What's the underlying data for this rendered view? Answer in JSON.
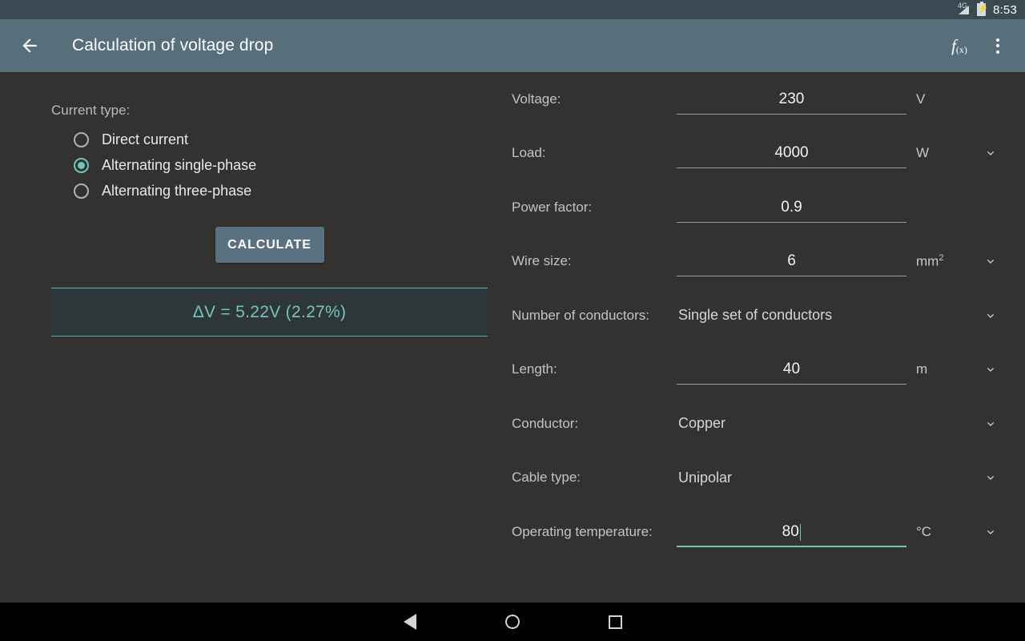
{
  "status_bar": {
    "network": "4G",
    "network_icon": "signal-4g-icon",
    "battery_icon": "battery-charging-icon",
    "time": "8:53"
  },
  "app_bar": {
    "back_icon": "arrow-back-icon",
    "title": "Calculation of voltage drop",
    "formula_icon": "fx-formula-icon",
    "formula_label": "f",
    "formula_sub": "(x)",
    "overflow_icon": "more-vertical-icon"
  },
  "current_type": {
    "label": "Current type:",
    "options": [
      {
        "label": "Direct current",
        "selected": false
      },
      {
        "label": "Alternating single-phase",
        "selected": true
      },
      {
        "label": "Alternating three-phase",
        "selected": false
      }
    ]
  },
  "calculate_button": {
    "label": "CALCULATE"
  },
  "result": {
    "text": "ΔV = 5.22V  (2.27%)"
  },
  "form": {
    "rows": [
      {
        "label": "Voltage:",
        "kind": "input",
        "value": "230",
        "unit": "V",
        "unit_sup": "",
        "chevron": false,
        "focused": false
      },
      {
        "label": "Load:",
        "kind": "input",
        "value": "4000",
        "unit": "W",
        "unit_sup": "",
        "chevron": true,
        "focused": false
      },
      {
        "label": "Power factor:",
        "kind": "input",
        "value": "0.9",
        "unit": "",
        "unit_sup": "",
        "chevron": false,
        "focused": false
      },
      {
        "label": "Wire size:",
        "kind": "input",
        "value": "6",
        "unit": "mm",
        "unit_sup": "2",
        "chevron": true,
        "focused": false
      },
      {
        "label": "Number of conductors:",
        "kind": "select",
        "value": "Single set of conductors",
        "unit": "",
        "unit_sup": "",
        "chevron": true,
        "focused": false
      },
      {
        "label": "Length:",
        "kind": "input",
        "value": "40",
        "unit": "m",
        "unit_sup": "",
        "chevron": true,
        "focused": false
      },
      {
        "label": "Conductor:",
        "kind": "select",
        "value": "Copper",
        "unit": "",
        "unit_sup": "",
        "chevron": true,
        "focused": false
      },
      {
        "label": "Cable type:",
        "kind": "select",
        "value": "Unipolar",
        "unit": "",
        "unit_sup": "",
        "chevron": true,
        "focused": false
      },
      {
        "label": "Operating temperature:",
        "kind": "input",
        "value": "80",
        "unit": "°C",
        "unit_sup": "",
        "chevron": true,
        "focused": true
      }
    ]
  },
  "nav_bar": {
    "back_icon": "nav-back-icon",
    "home_icon": "nav-home-icon",
    "recents_icon": "nav-recents-icon"
  },
  "colors": {
    "accent": "#6cc5b8",
    "app_bar": "#566f7a",
    "status_bar": "#3b4a52",
    "background": "#333231",
    "button": "#5a7280",
    "result_text": "#79c4ba"
  }
}
